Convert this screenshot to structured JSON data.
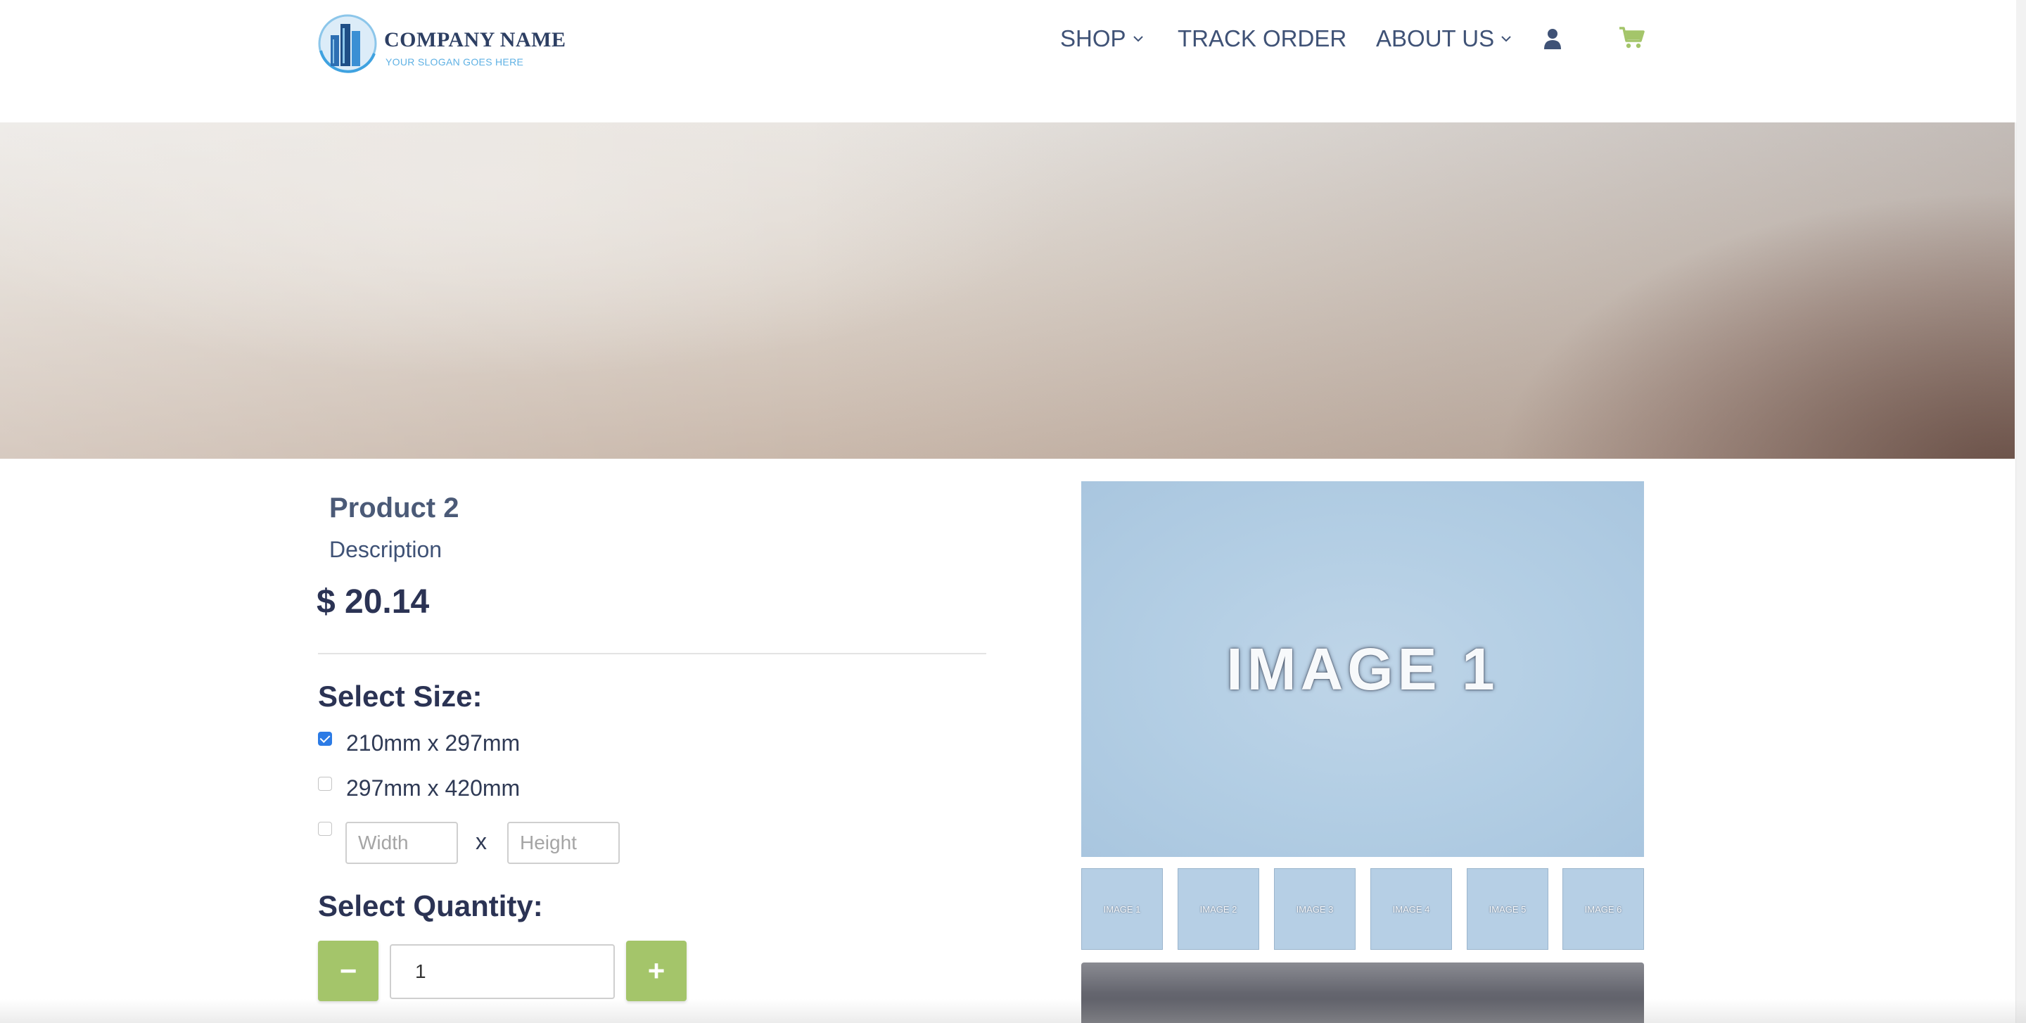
{
  "header": {
    "logo_name": "COMPANY NAME",
    "logo_slogan": "YOUR SLOGAN GOES HERE",
    "nav": {
      "shop": "SHOP",
      "track_order": "TRACK ORDER",
      "about_us": "ABOUT US"
    },
    "colors": {
      "accent": "#a4c56a",
      "nav_text": "#3f5276"
    }
  },
  "product": {
    "title": "Product 2",
    "description": "Description",
    "price": "$ 20.14"
  },
  "size": {
    "label": "Select Size:",
    "options": [
      {
        "label": "210mm x 297mm",
        "checked": true
      },
      {
        "label": "297mm x 420mm",
        "checked": false
      }
    ],
    "custom": {
      "width_placeholder": "Width",
      "height_placeholder": "Height",
      "separator": "x"
    }
  },
  "quantity": {
    "label": "Select Quantity:",
    "minus": "−",
    "plus": "+",
    "value": "1"
  },
  "gallery": {
    "main_label": "IMAGE 1",
    "thumbnails": [
      "IMAGE 1",
      "IMAGE 2",
      "IMAGE 3",
      "IMAGE 4",
      "IMAGE 5",
      "IMAGE 6"
    ]
  }
}
